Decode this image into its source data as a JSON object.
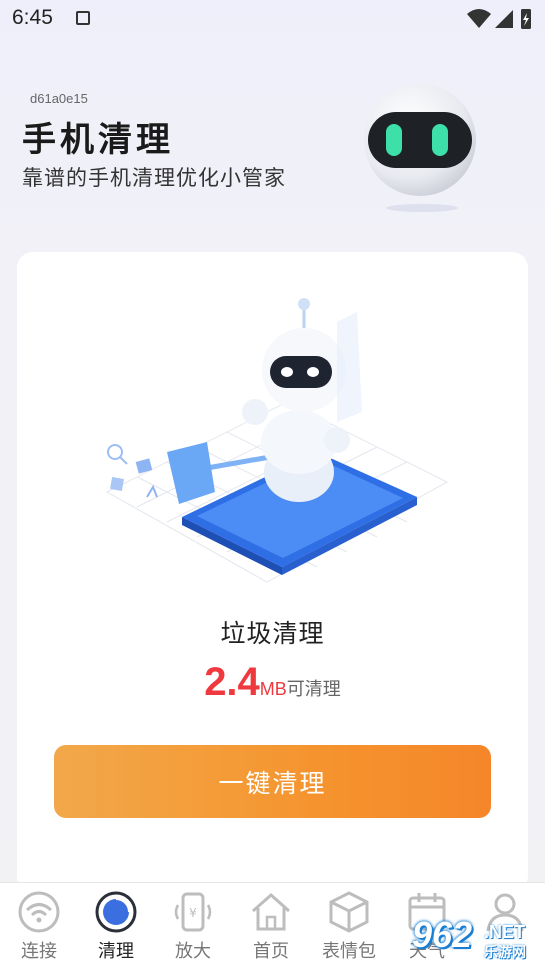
{
  "status_bar": {
    "time": "6:45",
    "icons": [
      "notification-a-icon",
      "wifi-icon",
      "signal-icon",
      "battery-charging-icon"
    ]
  },
  "header": {
    "code": "d61a0e15",
    "title": "手机清理",
    "subtitle": "靠谱的手机清理优化小管家"
  },
  "card": {
    "title": "垃圾清理",
    "size_value": "2.4",
    "size_unit": "MB",
    "size_note": "可清理",
    "button_label": "一键清理"
  },
  "tabs": [
    {
      "label": "连接",
      "icon": "wifi-icon",
      "active": false
    },
    {
      "label": "清理",
      "icon": "clean-icon",
      "active": true
    },
    {
      "label": "放大",
      "icon": "magnify-icon",
      "active": false
    },
    {
      "label": "首页",
      "icon": "home-icon",
      "active": false
    },
    {
      "label": "表情包",
      "icon": "box-icon",
      "active": false
    },
    {
      "label": "天气",
      "icon": "calendar-icon",
      "active": false
    },
    {
      "label": "",
      "icon": "user-icon",
      "active": false
    }
  ],
  "watermark": {
    "number": "962",
    "suffix": ".NET",
    "sub": "乐游网"
  },
  "colors": {
    "accent_red": "#ee3a3f",
    "button_orange": "#f5942e",
    "robot_blue": "#3b8cf0"
  }
}
